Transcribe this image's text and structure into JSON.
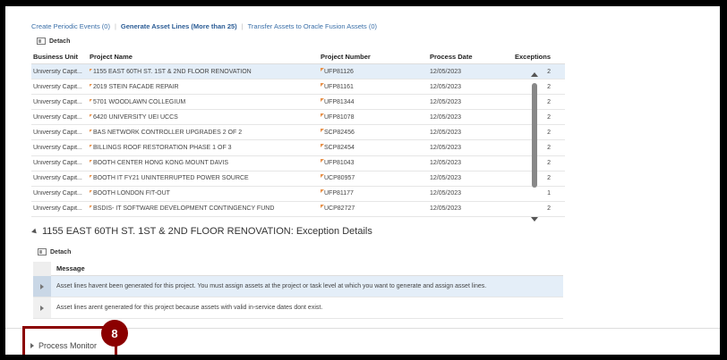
{
  "tabs": [
    {
      "label": "Create Periodic Events (0)"
    },
    {
      "label": "Generate Asset Lines (More than 25)"
    },
    {
      "label": "Transfer Assets to Oracle Fusion Assets (0)"
    }
  ],
  "detach_label": "Detach",
  "asset_table": {
    "columns": [
      "Business Unit",
      "Project Name",
      "Project Number",
      "Process Date",
      "Exceptions"
    ],
    "rows": [
      [
        "University Capit...",
        "1155 EAST 60TH ST. 1ST & 2ND FLOOR RENOVATION",
        "UFP81126",
        "12/05/2023",
        "2"
      ],
      [
        "University Capit...",
        "2019 STEIN FACADE REPAIR",
        "UFP81161",
        "12/05/2023",
        "2"
      ],
      [
        "University Capit...",
        "5701 WOODLAWN COLLEGIUM",
        "UFP81344",
        "12/05/2023",
        "2"
      ],
      [
        "University Capit...",
        "6420 UNIVERSITY UEI UCCS",
        "UFP81078",
        "12/05/2023",
        "2"
      ],
      [
        "University Capit...",
        "BAS NETWORK CONTROLLER UPGRADES 2 OF 2",
        "SCP82456",
        "12/05/2023",
        "2"
      ],
      [
        "University Capit...",
        "BILLINGS ROOF RESTORATION PHASE 1 OF 3",
        "SCP82454",
        "12/05/2023",
        "2"
      ],
      [
        "University Capit...",
        "BOOTH CENTER HONG KONG MOUNT DAVIS",
        "UFP81043",
        "12/05/2023",
        "2"
      ],
      [
        "University Capit...",
        "BOOTH IT FY21 UNINTERRUPTED POWER SOURCE",
        "UCP80957",
        "12/05/2023",
        "2"
      ],
      [
        "University Capit...",
        "BOOTH LONDON FIT-OUT",
        "UFP81177",
        "12/05/2023",
        "1"
      ],
      [
        "University Capit...",
        "BSDIS- IT SOFTWARE DEVELOPMENT CONTINGENCY FUND",
        "UCP82727",
        "12/05/2023",
        "2"
      ]
    ]
  },
  "exception_section": {
    "title": "1155 EAST 60TH ST. 1ST & 2ND FLOOR RENOVATION: Exception Details",
    "column": "Message",
    "messages": [
      "Asset lines havent been generated for this project. You must assign assets at the project or task level at which you want to generate and assign asset lines.",
      "Asset lines arent generated for this project because assets with valid in-service dates dont exist."
    ]
  },
  "process_monitor_label": "Process Monitor",
  "callout": {
    "number": "8",
    "color": "#8b0000"
  },
  "colors": {
    "link": "#3a6fa8",
    "selected_row": "#e4eef8",
    "flag": "#e8914a"
  }
}
